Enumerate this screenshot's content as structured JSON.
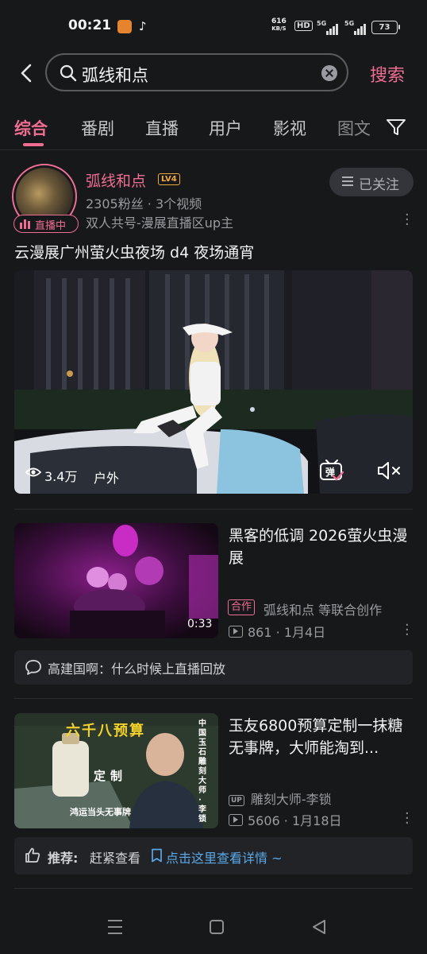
{
  "status_bar": {
    "time": "00:21",
    "net_speed_value": "616",
    "net_speed_unit": "KB/S",
    "hd": "HD",
    "sig1": "5G",
    "sig2": "5G",
    "battery": "73"
  },
  "search": {
    "query": "弧线和点",
    "submit_label": "搜索"
  },
  "tabs": [
    {
      "label": "综合",
      "active": true
    },
    {
      "label": "番剧"
    },
    {
      "label": "直播"
    },
    {
      "label": "用户"
    },
    {
      "label": "影视"
    },
    {
      "label": "图文"
    }
  ],
  "user_card": {
    "live_label": "直播中",
    "name": "弧线和点",
    "level": "LV4",
    "stats": "2305粉丝 · 3个视频",
    "description": "双人共号-漫展直播区up主",
    "follow_label": "已关注",
    "post_title": "云漫展广州萤火虫夜场 d4 夜场通宵",
    "views": "3.4万",
    "tag": "户外",
    "danmaku_label": "弹"
  },
  "results": [
    {
      "title": "黑客的低调 2026萤火虫漫展",
      "duration": "0:33",
      "collab_tag": "合作",
      "author": "弧线和点 等联合创作",
      "plays": "861",
      "date": "1月4日",
      "comment": "高建国啊：什么时候上直播回放"
    },
    {
      "title": "玉友6800预算定制一抹糖无事牌，大师能淘到...",
      "thumb_text_top": "六千八预算",
      "thumb_text_mid": "定制",
      "thumb_text_bottom": "鸿运当头无事牌",
      "thumb_text_side": "中国玉石雕刻大师 · 李锁",
      "up_badge": "UP",
      "author": "雕刻大师-李锁",
      "plays": "5606",
      "date": "1月18日",
      "reco_label": "推荐:",
      "reco_text": "赶紧查看",
      "reco_link": "点击这里查看详情 ~"
    }
  ],
  "colors": {
    "accent": "#f06d93",
    "background": "#17181a",
    "link": "#59a8e8"
  }
}
